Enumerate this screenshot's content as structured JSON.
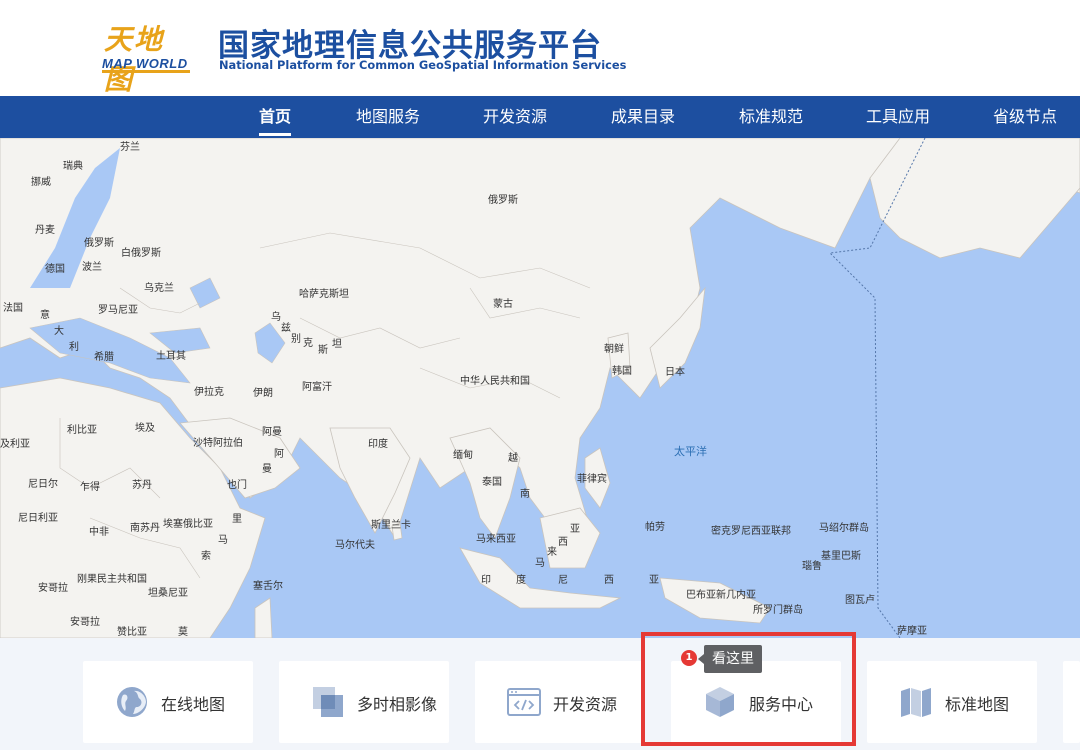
{
  "header": {
    "logo_cn": "天地图",
    "logo_en": "MAP WORLD",
    "title": "国家地理信息公共服务平台",
    "subtitle": "National Platform for Common GeoSpatial Information Services"
  },
  "nav": {
    "items": [
      {
        "label": "首页",
        "active": true
      },
      {
        "label": "地图服务"
      },
      {
        "label": "开发资源"
      },
      {
        "label": "成果目录"
      },
      {
        "label": "标准规范"
      },
      {
        "label": "工具应用"
      },
      {
        "label": "省级节点"
      }
    ]
  },
  "map": {
    "labels": [
      "芬兰",
      "瑞典",
      "挪威",
      "俄罗斯",
      "丹麦",
      "俄罗斯",
      "白俄罗斯",
      "德国",
      "波兰",
      "乌克兰",
      "法国",
      "罗马尼亚",
      "意",
      "大",
      "利",
      "哈萨克斯坦",
      "乌",
      "兹",
      "别",
      "克",
      "斯",
      "坦",
      "蒙古",
      "朝鲜",
      "韩国",
      "日本",
      "希腊",
      "土耳其",
      "伊拉克",
      "伊朗",
      "阿富汗",
      "中华人民共和国",
      "及利亚",
      "利比亚",
      "埃及",
      "沙特阿拉伯",
      "阿曼",
      "阿",
      "曼",
      "印度",
      "缅甸",
      "越",
      "泰国",
      "南",
      "菲律宾",
      "太平洋",
      "尼日尔",
      "乍得",
      "苏丹",
      "也门",
      "尼日利亚",
      "中非",
      "南苏丹",
      "埃塞俄比亚",
      "里",
      "马",
      "索",
      "斯里兰卡",
      "马尔代夫",
      "马来西亚",
      "亚",
      "西",
      "来",
      "马",
      "帕劳",
      "密克罗尼西亚联邦",
      "马绍尔群岛",
      "基里巴斯",
      "瑙鲁",
      "刚果民主共和国",
      "安哥拉",
      "坦桑尼亚",
      "塞舌尔",
      "印",
      "度",
      "尼",
      "西",
      "亚",
      "巴布亚新几内亚",
      "所罗门群岛",
      "图瓦卢",
      "安哥拉",
      "赞比亚",
      "莫",
      "萨摩亚"
    ]
  },
  "services": {
    "items": [
      {
        "label": "在线地图",
        "icon": "globe-icon"
      },
      {
        "label": "多时相影像",
        "icon": "layers-icon"
      },
      {
        "label": "开发资源",
        "icon": "code-window-icon"
      },
      {
        "label": "服务中心",
        "icon": "cube-icon"
      },
      {
        "label": "标准地图",
        "icon": "folded-map-icon"
      }
    ]
  },
  "annotation": {
    "badge": "1",
    "tooltip": "看这里",
    "highlight_color": "#e53935"
  },
  "colors": {
    "brand_blue": "#1d4fa0",
    "ocean": "#a9c8f5",
    "land": "#f4f3f0",
    "logo_gold": "#e8a31a"
  }
}
